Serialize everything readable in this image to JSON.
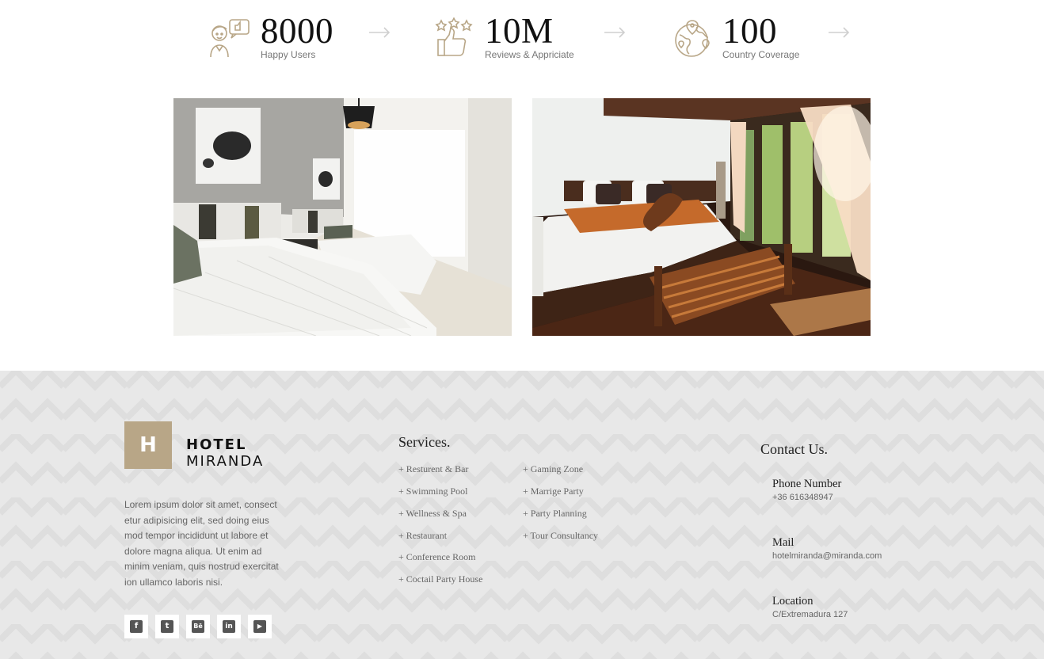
{
  "stats": [
    {
      "value": "8000",
      "label": "Happy Users",
      "icon": "happy-user-icon"
    },
    {
      "value": "10M",
      "label": "Reviews & Appriciate",
      "icon": "thumbs-up-stars-icon"
    },
    {
      "value": "100",
      "label": "Country Coverage",
      "icon": "globe-pins-icon"
    }
  ],
  "gallery": [
    {
      "name": "twin-bedroom-photo"
    },
    {
      "name": "king-bedroom-photo"
    }
  ],
  "footer": {
    "brand": {
      "letter": "H",
      "line1": "HOTEL",
      "line2": "MIRANDA"
    },
    "about": "Lorem ipsum dolor sit amet, consect etur adipisicing elit, sed doing eius mod tempor incididunt ut labore et dolore magna aliqua. Ut enim ad minim veniam, quis nostrud exercitat ion ullamco laboris nisi.",
    "socials": [
      {
        "icon": "facebook-icon",
        "glyph": "f"
      },
      {
        "icon": "twitter-icon",
        "glyph": "t"
      },
      {
        "icon": "behance-icon",
        "glyph": "Bē"
      },
      {
        "icon": "linkedin-icon",
        "glyph": "in"
      },
      {
        "icon": "youtube-icon",
        "glyph": "▶"
      }
    ],
    "services_title": "Services.",
    "services_col1": [
      "+ Resturent & Bar",
      "+ Swimming Pool",
      "+ Wellness & Spa",
      "+ Restaurant",
      "+ Conference Room",
      "+ Coctail Party House"
    ],
    "services_col2": [
      "+ Gaming Zone",
      "+ Marrige Party",
      "+ Party Planning",
      "+ Tour Consultancy"
    ],
    "contact_title": "Contact Us.",
    "contact": [
      {
        "label": "Phone Number",
        "value": "+36 616348947"
      },
      {
        "label": "Mail",
        "value": "hotelmiranda@miranda.com"
      },
      {
        "label": "Location",
        "value": "C/Extremadura 127"
      }
    ]
  },
  "colors": {
    "accent": "#b8a687",
    "footer_bg": "#e8e8e8",
    "text_muted": "#777777"
  }
}
